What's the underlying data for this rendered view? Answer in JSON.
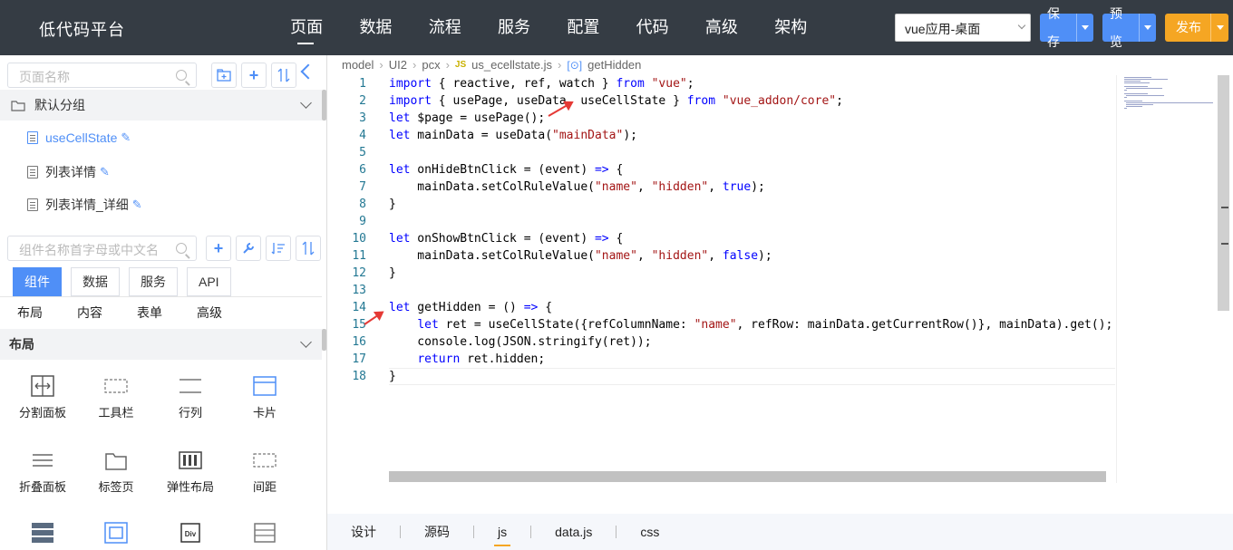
{
  "brand": "低代码平台",
  "nav": [
    "页面",
    "数据",
    "流程",
    "服务",
    "配置",
    "代码",
    "高级",
    "架构"
  ],
  "app_select": "vue应用-桌面",
  "actions": {
    "save": "保存",
    "preview": "预览",
    "publish": "发布"
  },
  "left": {
    "page_search_placeholder": "页面名称",
    "group_name": "默认分组",
    "pages": [
      "useCellState",
      "列表详情",
      "列表详情_详细"
    ],
    "comp_search_placeholder": "组件名称首字母或中文名",
    "tabs": [
      "组件",
      "数据",
      "服务",
      "API"
    ],
    "subtabs": [
      "布局",
      "内容",
      "表单",
      "高级"
    ],
    "section": "布局",
    "components": [
      "分割面板",
      "工具栏",
      "行列",
      "卡片",
      "折叠面板",
      "标签页",
      "弹性布局",
      "间距"
    ]
  },
  "breadcrumb": [
    "model",
    "UI2",
    "pcx",
    "us_ecellstate.js",
    "getHidden"
  ],
  "code_lines": [
    "import { reactive, ref, watch } from \"vue\";",
    "import { usePage, useData, useCellState } from \"vue_addon/core\";",
    "let $page = usePage();",
    "let mainData = useData(\"mainData\");",
    "",
    "let onHideBtnClick = (event) => {",
    "    mainData.setColRuleValue(\"name\", \"hidden\", true);",
    "}",
    "",
    "let onShowBtnClick = (event) => {",
    "    mainData.setColRuleValue(\"name\", \"hidden\", false);",
    "}",
    "",
    "let getHidden = () => {",
    "    let ret = useCellState({refColumnName: \"name\", refRow: mainData.getCurrentRow()}, mainData).get();",
    "    console.log(JSON.stringify(ret));",
    "    return ret.hidden;",
    "}"
  ],
  "bottom_tabs": [
    "设计",
    "源码",
    "js",
    "data.js",
    "css"
  ],
  "colors": {
    "topbar": "#353c44",
    "accent": "#4f8ff7",
    "publish": "#f5a623",
    "keyword": "#0000ff",
    "string": "#a31515"
  }
}
